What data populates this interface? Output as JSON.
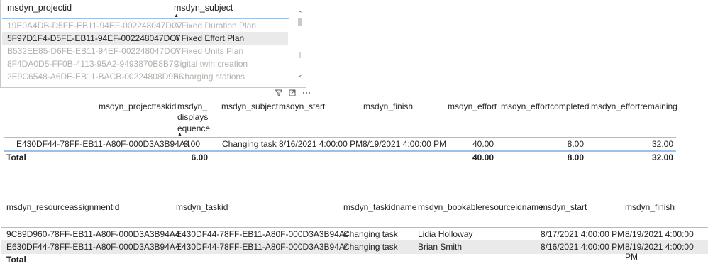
{
  "slicer": {
    "columns": [
      "msdyn_projectid",
      "msdyn_subject"
    ],
    "rows": [
      {
        "id": "19E0A4DB-D5FE-EB11-94EF-002248047DC7",
        "subject": "A Fixed Duration Plan"
      },
      {
        "id": "5F97D1F4-D5FE-EB11-94EF-002248047DC7",
        "subject": "A Fixed Effort Plan"
      },
      {
        "id": "B532EE85-D6FE-EB11-94EF-002248047DC7",
        "subject": "A Fixed Units Plan"
      },
      {
        "id": "8F4DA0D5-FF0B-4113-95A2-9493870B8B79",
        "subject": "Digital twin creation"
      },
      {
        "id": "2E9C6548-A6DE-EB11-BACB-00224808D9B6",
        "subject": "eCharging stations"
      }
    ]
  },
  "tasks": {
    "headers": {
      "taskid": "msdyn_projecttaskid",
      "seq_1": "msdyn_",
      "seq_2": "displays",
      "seq_3": "equence",
      "subject": "msdyn_subject",
      "start": "msdyn_start",
      "finish": "msdyn_finish",
      "effort": "msdyn_effort",
      "completed": "msdyn_effortcompleted",
      "remaining": "msdyn_effortremaining"
    },
    "row": {
      "taskid": "E430DF44-78FF-EB11-A80F-000D3A3B94A4",
      "seq": "6.00",
      "subject": "Changing task",
      "start": "8/16/2021 4:00:00 PM",
      "finish": "8/19/2021 4:00:00 PM",
      "effort": "40.00",
      "completed": "8.00",
      "remaining": "32.00"
    },
    "total": {
      "label": "Total",
      "seq": "6.00",
      "effort": "40.00",
      "completed": "8.00",
      "remaining": "32.00"
    }
  },
  "assignments": {
    "headers": {
      "id": "msdyn_resourceassignmentid",
      "taskid": "msdyn_taskid",
      "taskname": "msdyn_taskidname",
      "resource": "msdyn_bookableresourceidname",
      "start": "msdyn_start",
      "finish": "msdyn_finish"
    },
    "rows": [
      {
        "id": "9C89D960-78FF-EB11-A80F-000D3A3B94A4",
        "taskid": "E430DF44-78FF-EB11-A80F-000D3A3B94A4",
        "taskname": "Changing task",
        "resource": "Lidia Holloway",
        "start": "8/17/2021 4:00:00 PM",
        "finish": "8/19/2021 4:00:00 PM"
      },
      {
        "id": "E630DF44-78FF-EB11-A80F-000D3A3B94A4",
        "taskid": "E430DF44-78FF-EB11-A80F-000D3A3B94A4",
        "taskname": "Changing task",
        "resource": "Brian Smith",
        "start": "8/16/2021 4:00:00 PM",
        "finish": "8/19/2021 4:00:00 PM"
      }
    ],
    "total_label": "Total"
  },
  "icons": {
    "filter": "filter-icon",
    "focus": "focus-mode-icon",
    "more": "more-options-icon"
  }
}
